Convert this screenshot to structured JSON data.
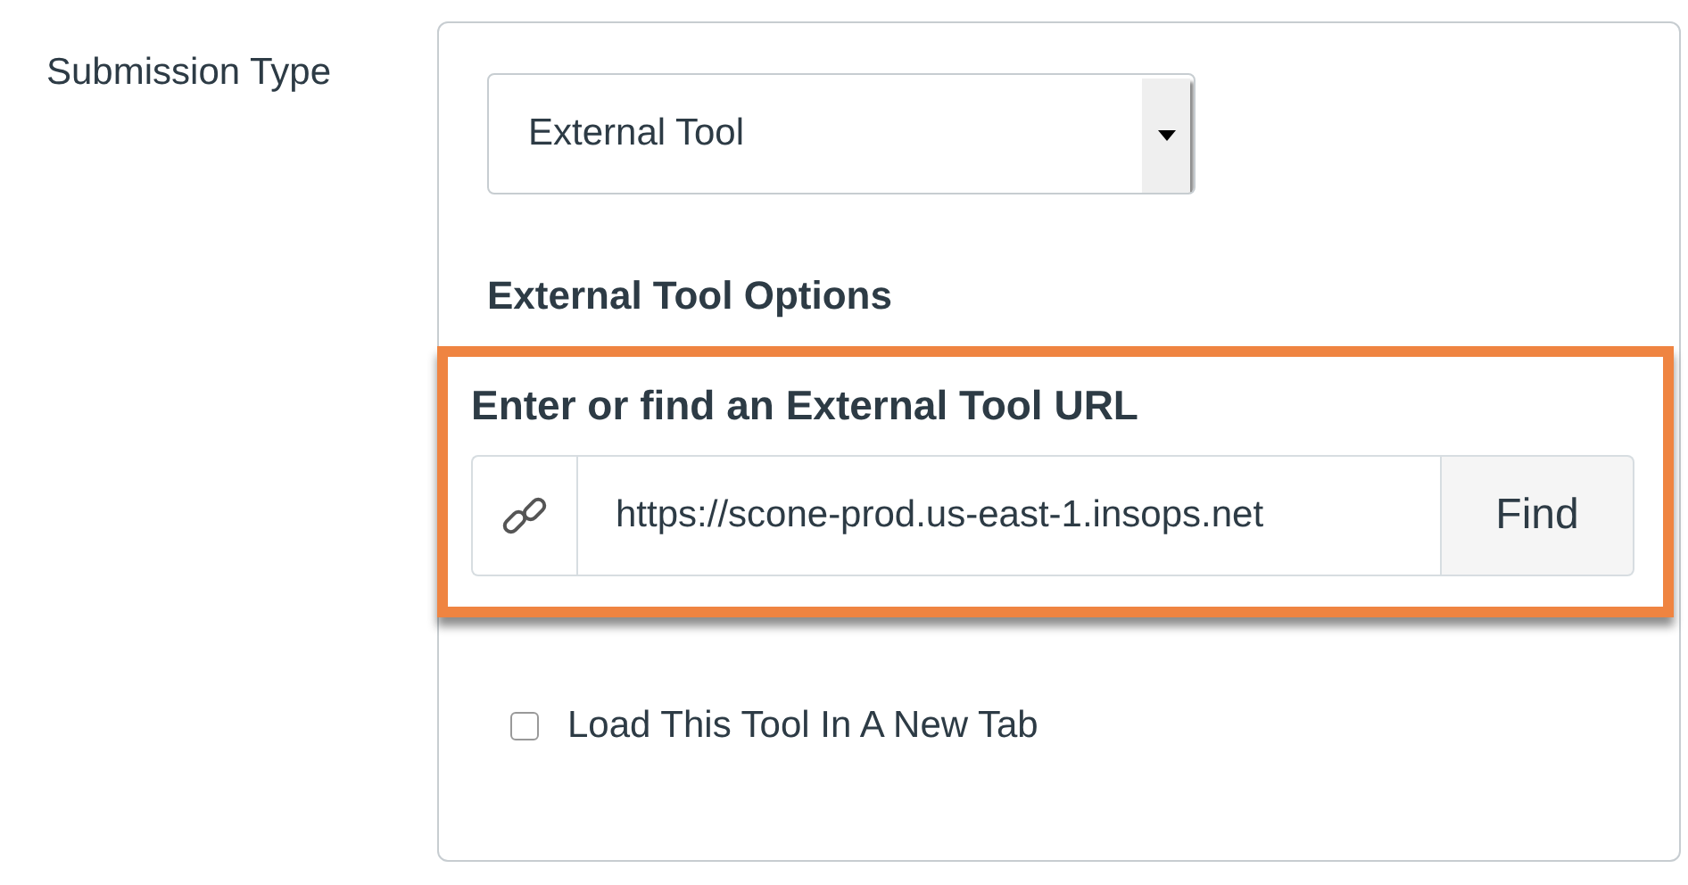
{
  "label": "Submission Type",
  "select": {
    "value": "External Tool"
  },
  "options_heading": "External Tool Options",
  "url_section": {
    "highlighted": true,
    "label": "Enter or find an External Tool URL",
    "value": "https://scone-prod.us-east-1.insops.net",
    "button": "Find"
  },
  "new_tab": {
    "label": "Load This Tool In A New Tab",
    "checked": false
  }
}
